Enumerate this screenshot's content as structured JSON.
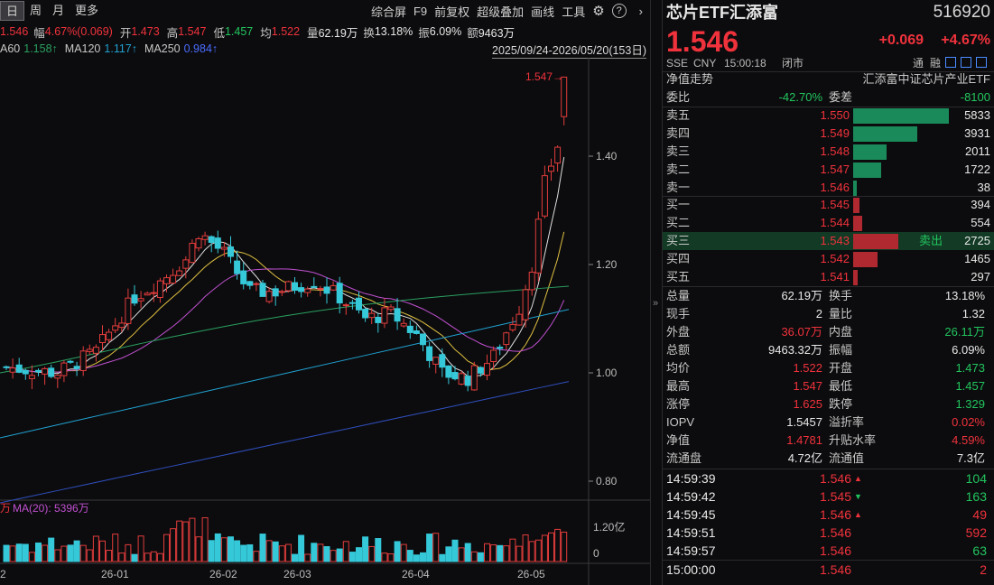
{
  "toolbar": {
    "periods": [
      "日",
      "周",
      "月",
      "更多"
    ],
    "tools": [
      "综合屏",
      "F9",
      "前复权",
      "超级叠加",
      "画线",
      "工具"
    ],
    "settings_icon": "gear-icon",
    "help_icon": "question-icon",
    "collapse_icon": "chevron-right-icon"
  },
  "indicators": {
    "price_label": "1.546",
    "change_label": "幅",
    "change_value": "4.67%(0.069)",
    "open_label": "开",
    "open_value": "1.473",
    "high_label": "高",
    "high_value": "1.547",
    "low_label": "低",
    "low_value": "1.457",
    "avg_label": "均",
    "avg_value": "1.522",
    "volume_label": "量",
    "volume_value": "62.19万",
    "turnover_label": "换",
    "turnover_value": "13.18%",
    "amp_label": "振",
    "amp_value": "6.09%",
    "amount_label": "额",
    "amount_value": "9463万",
    "ma60": "A60",
    "ma60_value": "1.158↑",
    "ma120": "MA120",
    "ma120_value": "1.117↑",
    "ma250": "MA250",
    "ma250_value": "0.984↑",
    "date_range": "2025/09/24-2026/05/20(153日)"
  },
  "chart": {
    "price_ticks": [
      "1.40",
      "1.20",
      "1.00",
      "0.80"
    ],
    "max_label": "1.547→",
    "volume_legend_prefix": "万",
    "volume_ma_label": "MA(20): 5396万",
    "volume_ticks": [
      "1.20亿",
      "0"
    ],
    "date_ticks": [
      "2",
      "26-01",
      "26-02",
      "26-03",
      "26-04",
      "26-05"
    ]
  },
  "quote": {
    "name": "芯片ETF汇添富",
    "code": "516920",
    "price": "1.546",
    "change": "+0.069",
    "change_pct": "+4.67%",
    "exchange": "SSE",
    "currency": "CNY",
    "time": "15:00:18",
    "status": "闭市",
    "tong": "通",
    "rong": "融",
    "nav_trend": "净值走势",
    "index_name": "汇添富中证芯片产业ETF",
    "weibi_label": "委比",
    "weibi_value": "-42.70%",
    "weicha_label": "委差",
    "weicha_value": "-8100"
  },
  "orderbook": {
    "asks": [
      {
        "label": "卖五",
        "price": "1.550",
        "vol": "5833",
        "ratio": 1.0
      },
      {
        "label": "卖四",
        "price": "1.549",
        "vol": "3931",
        "ratio": 0.674
      },
      {
        "label": "卖三",
        "price": "1.548",
        "vol": "2011",
        "ratio": 0.345
      },
      {
        "label": "卖二",
        "price": "1.547",
        "vol": "1722",
        "ratio": 0.295
      },
      {
        "label": "卖一",
        "price": "1.546",
        "vol": "38",
        "ratio": 0.0065
      }
    ],
    "bids": [
      {
        "label": "买一",
        "price": "1.545",
        "vol": "394",
        "ratio": 0.0675
      },
      {
        "label": "买二",
        "price": "1.544",
        "vol": "554",
        "ratio": 0.095
      },
      {
        "label": "买三",
        "price": "1.543",
        "vol": "2725",
        "ratio": 0.467,
        "tag": "卖出"
      },
      {
        "label": "买四",
        "price": "1.542",
        "vol": "1465",
        "ratio": 0.251
      },
      {
        "label": "买五",
        "price": "1.541",
        "vol": "297",
        "ratio": 0.051
      }
    ]
  },
  "stats": [
    {
      "l1": "总量",
      "v1": "62.19万",
      "c1": "white",
      "l2": "换手",
      "v2": "13.18%",
      "c2": "white"
    },
    {
      "l1": "现手",
      "v1": "2",
      "c1": "white",
      "l2": "量比",
      "v2": "1.32",
      "c2": "white"
    },
    {
      "l1": "外盘",
      "v1": "36.07万",
      "c1": "up",
      "l2": "内盘",
      "v2": "26.11万",
      "c2": "down"
    },
    {
      "l1": "总额",
      "v1": "9463.32万",
      "c1": "white",
      "l2": "振幅",
      "v2": "6.09%",
      "c2": "white"
    },
    {
      "l1": "均价",
      "v1": "1.522",
      "c1": "up",
      "l2": "开盘",
      "v2": "1.473",
      "c2": "down"
    },
    {
      "l1": "最高",
      "v1": "1.547",
      "c1": "up",
      "l2": "最低",
      "v2": "1.457",
      "c2": "down"
    },
    {
      "l1": "涨停",
      "v1": "1.625",
      "c1": "up",
      "l2": "跌停",
      "v2": "1.329",
      "c2": "down"
    },
    {
      "l1": "IOPV",
      "v1": "1.5457",
      "c1": "white",
      "l2": "溢折率",
      "v2": "0.02%",
      "c2": "up"
    },
    {
      "l1": "净值",
      "v1": "1.4781",
      "c1": "up",
      "l2": "升贴水率",
      "v2": "4.59%",
      "c2": "up"
    },
    {
      "l1": "流通盘",
      "v1": "4.72亿",
      "c1": "white",
      "l2": "流通值",
      "v2": "7.3亿",
      "c2": "white"
    }
  ],
  "ticks": [
    {
      "time": "14:59:39",
      "price": "1.546",
      "arrow": "up",
      "vol": "104",
      "vc": "down"
    },
    {
      "time": "14:59:42",
      "price": "1.545",
      "arrow": "down",
      "vol": "163",
      "vc": "down"
    },
    {
      "time": "14:59:45",
      "price": "1.546",
      "arrow": "up",
      "vol": "49",
      "vc": "up"
    },
    {
      "time": "14:59:51",
      "price": "1.546",
      "arrow": "",
      "vol": "592",
      "vc": "up"
    },
    {
      "time": "14:59:57",
      "price": "1.546",
      "arrow": "",
      "vol": "63",
      "vc": "down"
    },
    {
      "time": "15:00:00",
      "price": "1.546",
      "arrow": "",
      "vol": "2",
      "vc": "up"
    }
  ],
  "colors": {
    "up": "#f0323c",
    "down": "#22c55e",
    "candle_up": "#e23c3c",
    "candle_down": "#35c8d8",
    "ma5": "#e0e0e0",
    "ma10": "#e0c040",
    "ma20": "#c050d0",
    "ma60": "#2aa060",
    "ma120": "#20a0d0",
    "ma250": "#3050c0",
    "ask_bar": "#1a8a5a",
    "bid_bar": "#b02830"
  }
}
